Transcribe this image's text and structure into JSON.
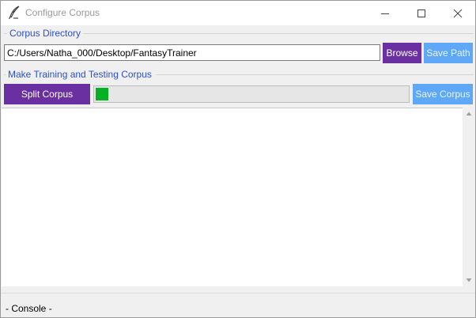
{
  "window": {
    "title": "Configure Corpus",
    "title_icon": "quill-pen-icon"
  },
  "corpus_directory": {
    "label": "Corpus Directory",
    "path_value": "C:/Users/Natha_000/Desktop/FantasyTrainer",
    "browse_label": "Browse",
    "save_path_label": "Save Path"
  },
  "training": {
    "label": "Make Training and Testing Corpus",
    "split_label": "Split Corpus",
    "save_corpus_label": "Save Corpus",
    "progress_fraction": 0.04
  },
  "console": {
    "label": "- Console -",
    "content": ""
  },
  "colors": {
    "accent_purple": "#6a2fa0",
    "accent_blue": "#5ea8f7",
    "section_label": "#2a50d6",
    "progress_green": "#06b025"
  }
}
